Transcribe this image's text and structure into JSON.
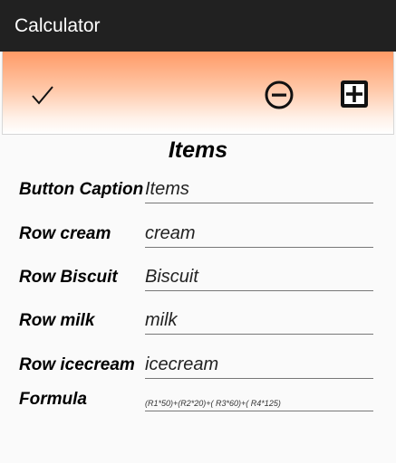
{
  "app": {
    "title": "Calculator"
  },
  "toolbar": {
    "confirm_icon": "checkmark-icon",
    "remove_icon": "minus-circle-icon",
    "add_icon": "plus-square-icon",
    "gradient_top": "#ff9a66"
  },
  "section": {
    "title": "Items"
  },
  "form": {
    "rows": [
      {
        "label": "Button Caption",
        "value": "Items"
      },
      {
        "label": "Row cream",
        "value": "cream"
      },
      {
        "label": "Row Biscuit",
        "value": "Biscuit"
      },
      {
        "label": "Row milk",
        "value": "milk"
      },
      {
        "label": "Row icecream",
        "value": "icecream"
      },
      {
        "label": "Formula",
        "value": "(R1*50)+(R2*20)+( R3*60)+( R4*125)"
      }
    ]
  }
}
